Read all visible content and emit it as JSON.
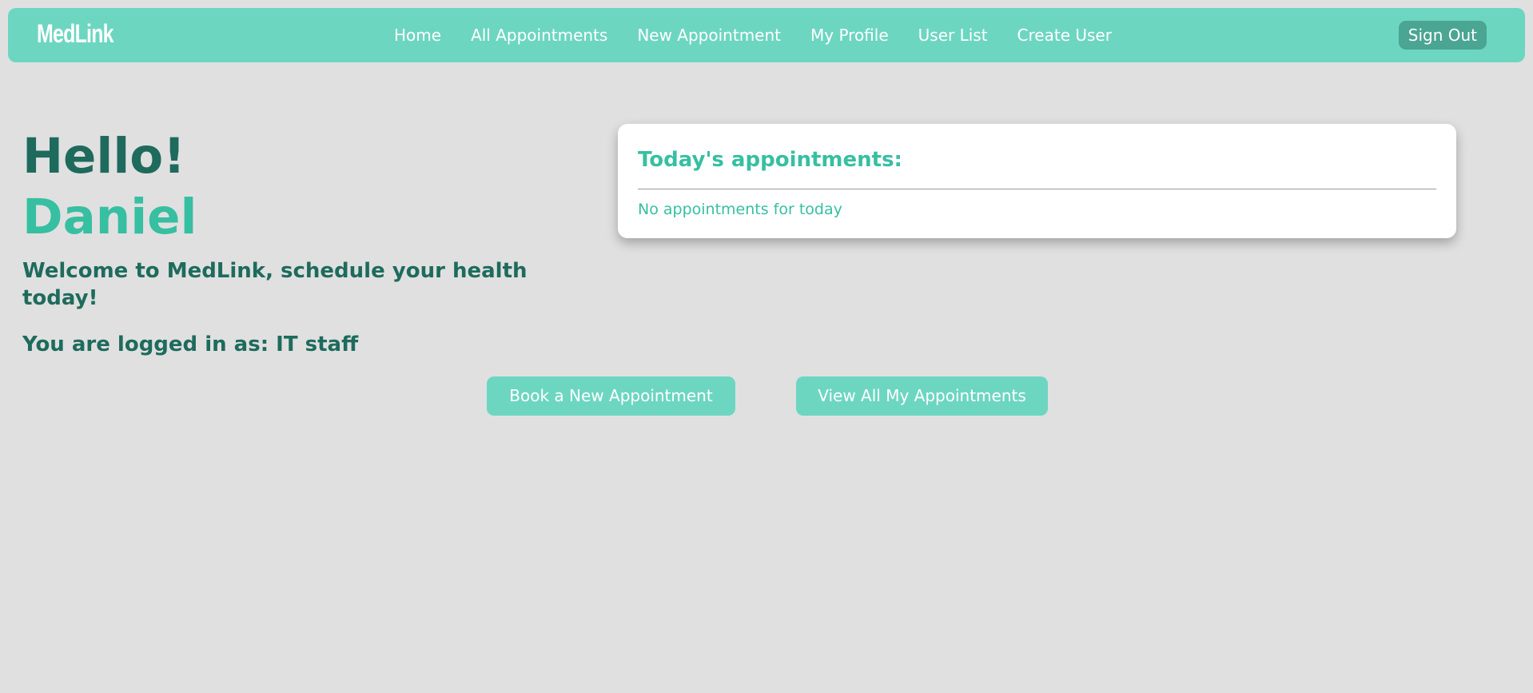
{
  "nav": {
    "logo": "MedLink",
    "links": [
      "Home",
      "All Appointments",
      "New Appointment",
      "My Profile",
      "User List",
      "Create User"
    ],
    "sign_out": "Sign Out"
  },
  "greeting": {
    "hello": "Hello!",
    "name": "Daniel",
    "welcome": "Welcome to MedLink, schedule your health today!",
    "logged_in": "You are logged in as: IT staff"
  },
  "appointments_card": {
    "title": "Today's appointments:",
    "empty_message": "No appointments for today"
  },
  "actions": {
    "book": "Book a New Appointment",
    "view_all": "View All My Appointments"
  },
  "colors": {
    "nav_bg": "#6dd6c1",
    "accent_dark": "#1e6b5d",
    "accent": "#37bfa2",
    "sign_out_bg": "#4ba593",
    "page_bg": "#e0e0e0"
  }
}
